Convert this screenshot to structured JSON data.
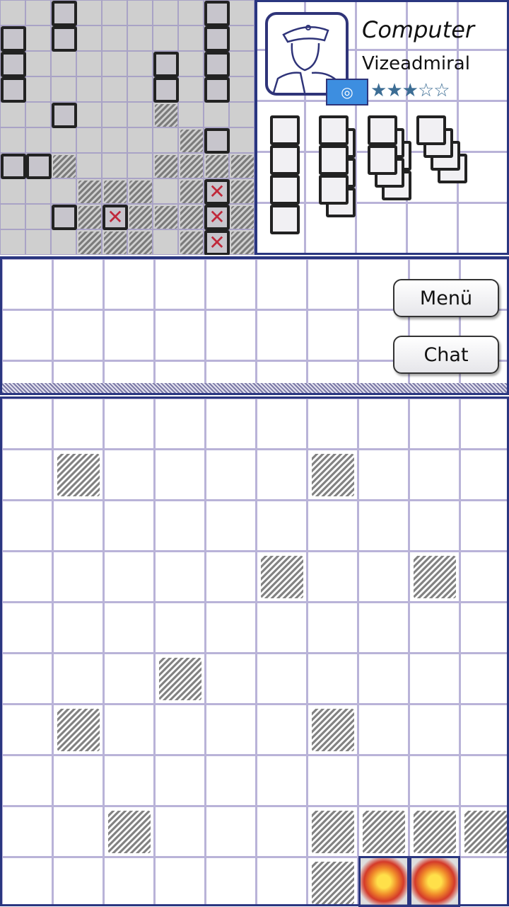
{
  "player": {
    "name": "Computer",
    "rank": "Vizeadmiral",
    "flag": "un-flag",
    "stars": 3,
    "max_stars": 5,
    "star_full": "★",
    "star_empty": "☆"
  },
  "buttons": {
    "menu": "Menü",
    "chat": "Chat"
  },
  "own_board": {
    "ships": [
      [
        [
          0,
          1
        ],
        [
          0,
          2
        ],
        [
          0,
          3
        ]
      ],
      [
        [
          2,
          0
        ],
        [
          2,
          1
        ]
      ],
      [
        [
          8,
          0
        ],
        [
          8,
          1
        ],
        [
          8,
          2
        ],
        [
          8,
          3
        ]
      ],
      [
        [
          6,
          2
        ],
        [
          6,
          3
        ]
      ],
      [
        [
          2,
          4
        ]
      ],
      [
        [
          8,
          5
        ]
      ],
      [
        [
          0,
          6
        ],
        [
          1,
          6
        ]
      ],
      [
        [
          2,
          8
        ]
      ],
      [
        [
          4,
          8
        ]
      ],
      [
        [
          8,
          7
        ],
        [
          8,
          8
        ],
        [
          8,
          9
        ]
      ]
    ],
    "hits": [
      [
        4,
        8
      ],
      [
        8,
        7
      ],
      [
        8,
        8
      ],
      [
        8,
        9
      ]
    ],
    "misses": [
      [
        6,
        4
      ],
      [
        7,
        5
      ],
      [
        2,
        6
      ],
      [
        6,
        6
      ],
      [
        7,
        6
      ],
      [
        8,
        6
      ],
      [
        9,
        6
      ],
      [
        3,
        7
      ],
      [
        4,
        7
      ],
      [
        5,
        7
      ],
      [
        7,
        7
      ],
      [
        9,
        7
      ],
      [
        3,
        8
      ],
      [
        5,
        8
      ],
      [
        6,
        8
      ],
      [
        7,
        8
      ],
      [
        9,
        8
      ],
      [
        3,
        9
      ],
      [
        4,
        9
      ],
      [
        5,
        9
      ],
      [
        7,
        9
      ],
      [
        9,
        9
      ]
    ]
  },
  "enemy_board": {
    "misses": [
      [
        1,
        1
      ],
      [
        6,
        1
      ],
      [
        5,
        3
      ],
      [
        8,
        3
      ],
      [
        3,
        5
      ],
      [
        1,
        6
      ],
      [
        6,
        6
      ],
      [
        2,
        8
      ],
      [
        6,
        8
      ],
      [
        7,
        8
      ],
      [
        8,
        8
      ],
      [
        9,
        8
      ],
      [
        6,
        9
      ]
    ],
    "hits": [
      [
        7,
        9
      ],
      [
        8,
        9
      ]
    ]
  },
  "fleet_remaining": [
    {
      "size": 4,
      "count": 1
    },
    {
      "size": 3,
      "count": 2
    },
    {
      "size": 2,
      "count": 3
    },
    {
      "size": 1,
      "count": 4
    }
  ]
}
